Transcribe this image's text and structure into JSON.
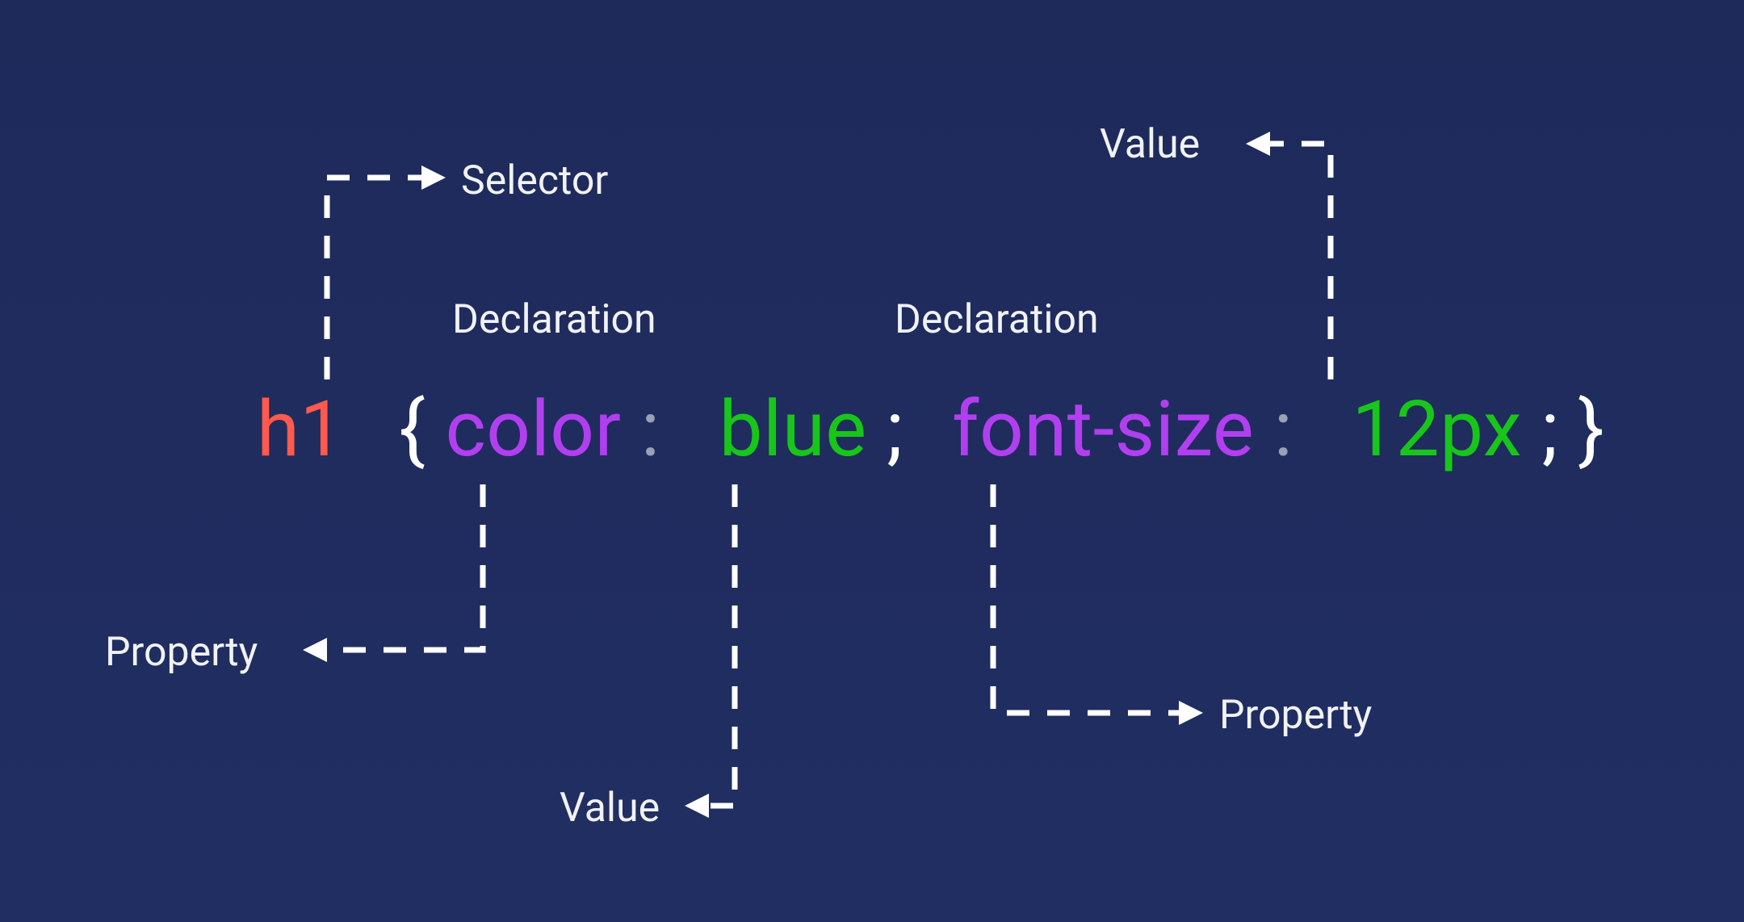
{
  "labels": {
    "selector": "Selector",
    "declaration1": "Declaration",
    "declaration2": "Declaration",
    "property1": "Property",
    "property2": "Property",
    "value1": "Value",
    "value2": "Value"
  },
  "code": {
    "selector": "h1",
    "brace_open": "{",
    "prop1": "color",
    "colon1": ":",
    "val1": "blue",
    "semi1": ";",
    "prop2": "font-size",
    "colon2": ":",
    "val2": "12px",
    "semi2": ";",
    "brace_close": "}"
  },
  "colors": {
    "selector": "#ff5a4d",
    "property": "#b13ff0",
    "value": "#18c61a",
    "punct": "#ffffff",
    "bg": "#1f2a5c"
  }
}
